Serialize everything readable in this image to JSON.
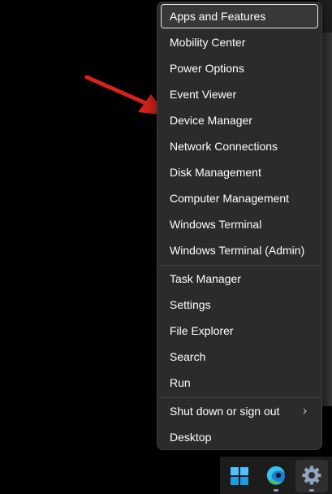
{
  "context_menu": {
    "groups": [
      {
        "items": [
          {
            "label": "Apps and Features",
            "highlighted": true
          },
          {
            "label": "Mobility Center"
          },
          {
            "label": "Power Options"
          },
          {
            "label": "Event Viewer"
          },
          {
            "label": "Device Manager"
          },
          {
            "label": "Network Connections"
          },
          {
            "label": "Disk Management"
          },
          {
            "label": "Computer Management"
          },
          {
            "label": "Windows Terminal"
          },
          {
            "label": "Windows Terminal (Admin)"
          }
        ]
      },
      {
        "items": [
          {
            "label": "Task Manager"
          },
          {
            "label": "Settings"
          },
          {
            "label": "File Explorer"
          },
          {
            "label": "Search"
          },
          {
            "label": "Run"
          }
        ]
      },
      {
        "items": [
          {
            "label": "Shut down or sign out",
            "has_submenu": true,
            "submenu_icon": "chevron-right-icon"
          },
          {
            "label": "Desktop"
          }
        ]
      }
    ]
  },
  "annotation": {
    "icon": "red-arrow-icon",
    "points_to": "Device Manager",
    "color": "#d9221c"
  },
  "taskbar": {
    "icons": [
      {
        "name": "windows-start-icon",
        "accent": "#4cc2ff"
      },
      {
        "name": "edge-browser-icon",
        "accent": "#2fb5e6"
      },
      {
        "name": "settings-gear-icon",
        "accent": "#9fb4c8",
        "active": true
      }
    ]
  }
}
